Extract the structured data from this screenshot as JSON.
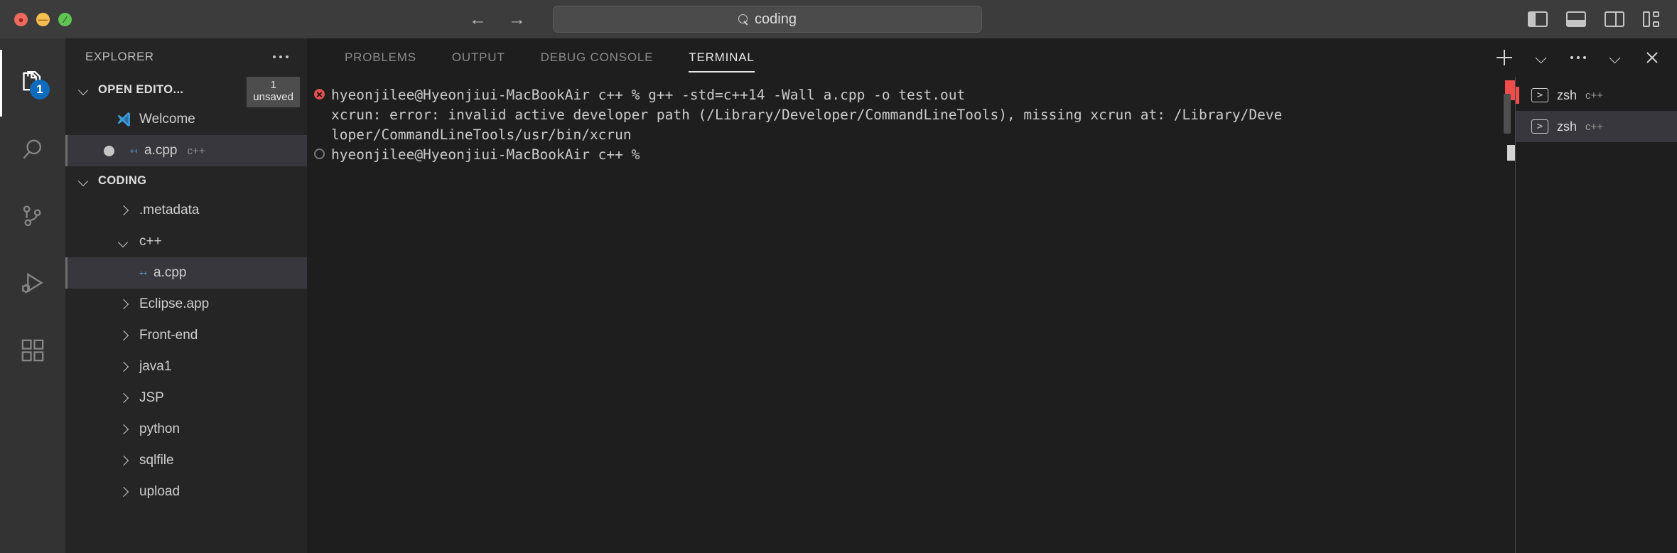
{
  "titlebar": {
    "window_controls": [
      {
        "name": "close",
        "color": "#ed6a5f",
        "glyph": "●"
      },
      {
        "name": "minimize",
        "color": "#f5bf4f",
        "glyph": "—"
      },
      {
        "name": "maximize",
        "color": "#61c554",
        "glyph": "⁄"
      }
    ],
    "back_arrow": "←",
    "forward_arrow": "→",
    "search": {
      "value": "coding",
      "icon": "search-icon"
    },
    "layout_icons": [
      "toggle-primary-sidebar-icon",
      "toggle-panel-icon",
      "toggle-secondary-sidebar-icon",
      "customize-layout-icon"
    ]
  },
  "activitybar": {
    "items": [
      {
        "id": "explorer",
        "icon": "files-icon",
        "active": true,
        "badge": "1"
      },
      {
        "id": "search",
        "icon": "search-icon",
        "active": false,
        "badge": ""
      },
      {
        "id": "source-control",
        "icon": "source-control-icon",
        "active": false,
        "badge": ""
      },
      {
        "id": "run-debug",
        "icon": "run-and-debug-icon",
        "active": false,
        "badge": ""
      },
      {
        "id": "extensions",
        "icon": "extensions-icon",
        "active": false,
        "badge": ""
      }
    ]
  },
  "sidebar": {
    "title": "EXPLORER",
    "more_actions_icon": "ellipsis-icon",
    "open_editors": {
      "label": "OPEN EDITO...",
      "badge_count": "1",
      "badge_text": "unsaved",
      "expanded": true,
      "items": [
        {
          "label": "Welcome",
          "icon": "vscode-logo-icon",
          "hint": "",
          "dirty": false,
          "selected": false
        },
        {
          "label": "a.cpp",
          "icon": "cpp-file-icon",
          "hint": "c++",
          "dirty": true,
          "selected": true
        }
      ]
    },
    "workspace": {
      "label": "CODING",
      "expanded": true,
      "tree": [
        {
          "label": ".metadata",
          "type": "folder",
          "expanded": false,
          "depth": 1,
          "selected": false
        },
        {
          "label": "c++",
          "type": "folder",
          "expanded": true,
          "depth": 1,
          "selected": false
        },
        {
          "label": "a.cpp",
          "type": "cpp-file",
          "expanded": false,
          "depth": 2,
          "selected": true
        },
        {
          "label": "Eclipse.app",
          "type": "folder",
          "expanded": false,
          "depth": 1,
          "selected": false
        },
        {
          "label": "Front-end",
          "type": "folder",
          "expanded": false,
          "depth": 1,
          "selected": false
        },
        {
          "label": "java1",
          "type": "folder",
          "expanded": false,
          "depth": 1,
          "selected": false
        },
        {
          "label": "JSP",
          "type": "folder",
          "expanded": false,
          "depth": 1,
          "selected": false
        },
        {
          "label": "python",
          "type": "folder",
          "expanded": false,
          "depth": 1,
          "selected": false
        },
        {
          "label": "sqlfile",
          "type": "folder",
          "expanded": false,
          "depth": 1,
          "selected": false
        },
        {
          "label": "upload",
          "type": "folder",
          "expanded": false,
          "depth": 1,
          "selected": false
        }
      ]
    }
  },
  "panel": {
    "tabs": [
      {
        "label": "PROBLEMS",
        "active": false
      },
      {
        "label": "OUTPUT",
        "active": false
      },
      {
        "label": "DEBUG CONSOLE",
        "active": false
      },
      {
        "label": "TERMINAL",
        "active": true
      }
    ],
    "actions": [
      "new-terminal-icon",
      "new-terminal-dropdown-icon",
      "terminal-more-actions-icon",
      "hide-panel-icon",
      "close-panel-icon"
    ],
    "terminal": {
      "lines": [
        {
          "marker": "error",
          "text": "hyeonjilee@Hyeonjiui-MacBookAir c++ % g++ -std=c++14 -Wall a.cpp -o test.out"
        },
        {
          "marker": "none",
          "text": "xcrun: error: invalid active developer path (/Library/Developer/CommandLineTools), missing xcrun at: /Library/Deve"
        },
        {
          "marker": "none",
          "text": "loper/CommandLineTools/usr/bin/xcrun"
        },
        {
          "marker": "prompt",
          "text": "hyeonjilee@Hyeonjiui-MacBookAir c++ % "
        }
      ]
    },
    "terminal_tabs": [
      {
        "name": "zsh",
        "sub": "c++",
        "icon": "terminal-shell-icon",
        "selected": false,
        "has_error": true
      },
      {
        "name": "zsh",
        "sub": "c++",
        "icon": "terminal-shell-icon",
        "selected": true,
        "has_error": false
      }
    ]
  },
  "colors": {
    "titlebar_bg": "#3c3c3c",
    "sidebar_bg": "#252526",
    "activitybar_bg": "#333333",
    "editor_bg": "#1e1e1e",
    "selection_bg": "#37373d",
    "badge_blue": "#0f6cbd",
    "error_red": "#f14c4c",
    "text": "#cccccc"
  }
}
